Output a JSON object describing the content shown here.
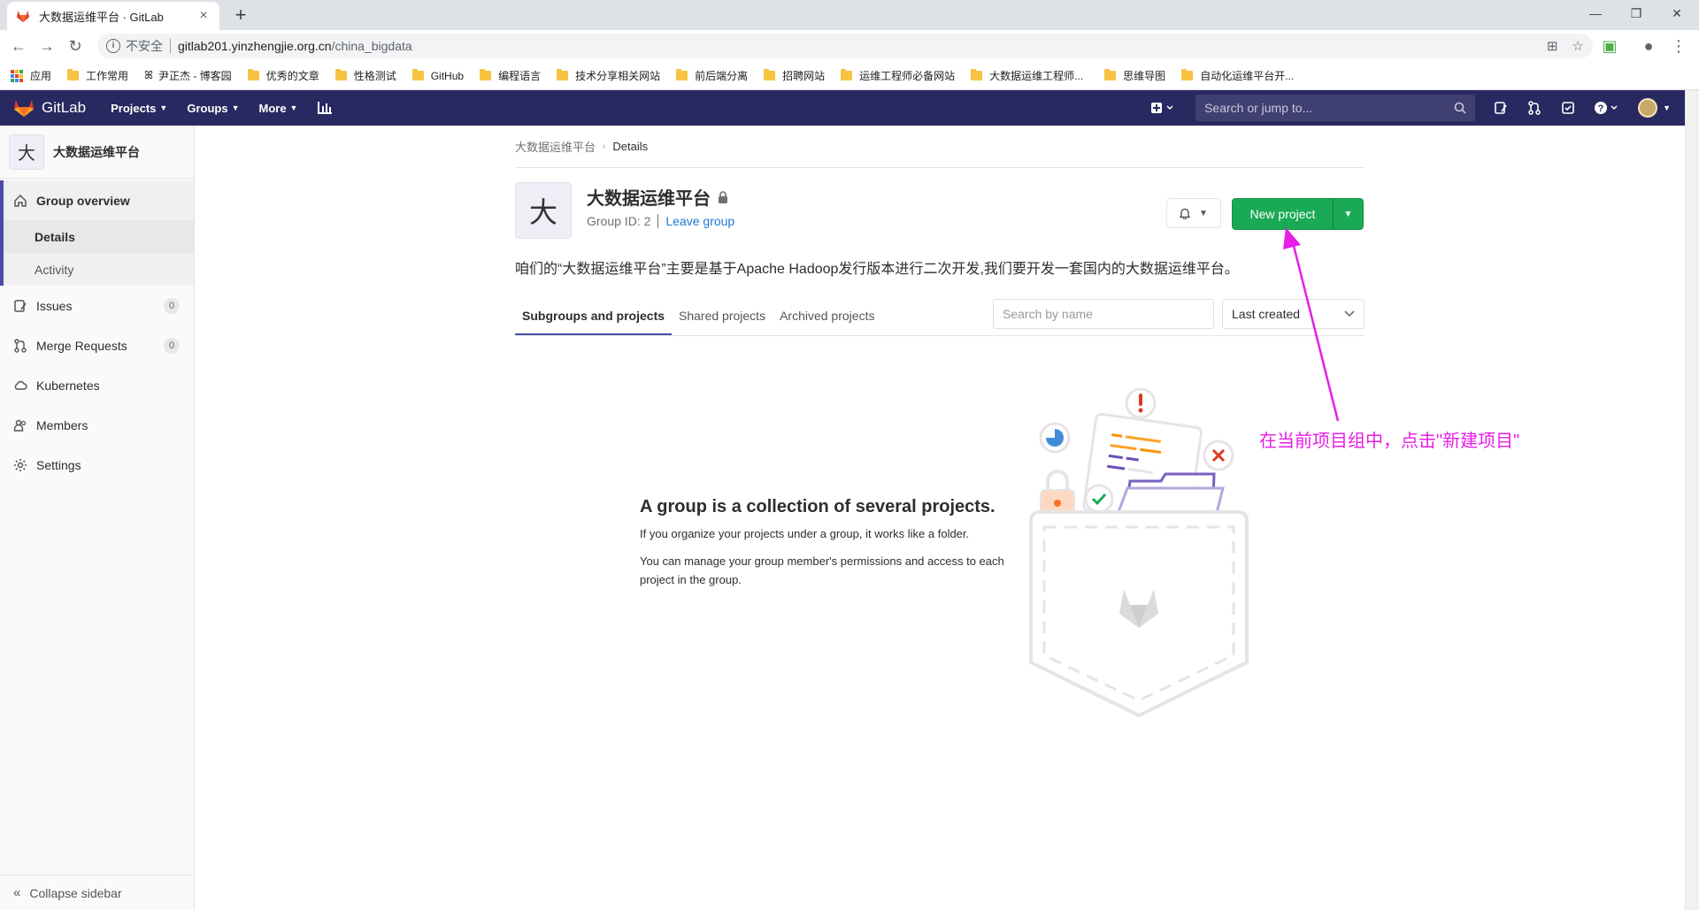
{
  "browser": {
    "tab_title": "大数据运维平台 · GitLab",
    "insecure_label": "不安全",
    "url_host": "gitlab201.yinzhengjie.org.cn",
    "url_path": "/china_bigdata",
    "bookmarks": {
      "apps": "应用",
      "b1": "工作常用",
      "b2": "尹正杰 - 博客园",
      "b3": "优秀的文章",
      "b4": "性格测试",
      "b5": "GitHub",
      "b6": "编程语言",
      "b7": "技术分享相关网站",
      "b8": "前后端分离",
      "b9": "招聘网站",
      "b10": "运维工程师必备网站",
      "b11": "大数据运维工程师...",
      "b12": "思维导图",
      "b13": "自动化运维平台开..."
    }
  },
  "header": {
    "brand": "GitLab",
    "nav_projects": "Projects",
    "nav_groups": "Groups",
    "nav_more": "More",
    "search_placeholder": "Search or jump to..."
  },
  "sidebar": {
    "group_initial": "大",
    "group_name": "大数据运维平台",
    "overview": "Group overview",
    "details": "Details",
    "activity": "Activity",
    "issues": "Issues",
    "issues_count": "0",
    "merge_requests": "Merge Requests",
    "mr_count": "0",
    "kubernetes": "Kubernetes",
    "members": "Members",
    "settings": "Settings",
    "collapse": "Collapse sidebar"
  },
  "main": {
    "breadcrumb_group": "大数据运维平台",
    "breadcrumb_current": "Details",
    "group_initial": "大",
    "group_title": "大数据运维平台",
    "group_id": "Group ID: 2",
    "leave_group": "Leave group",
    "new_project": "New project",
    "description": "咱们的“大数据运维平台”主要是基于Apache Hadoop发行版本进行二次开发,我们要开发一套国内的大数据运维平台。",
    "tabs": [
      "Subgroups and projects",
      "Shared projects",
      "Archived projects"
    ],
    "search_placeholder": "Search by name",
    "sort_value": "Last created",
    "empty_title": "A group is a collection of several projects.",
    "empty_p1": "If you organize your projects under a group, it works like a folder.",
    "empty_p2": "You can manage your group member's permissions and access to each project in the group."
  },
  "annotation": {
    "text": "在当前项目组中，点击\"新建项目\"",
    "color": "#e61ee6"
  },
  "colors": {
    "header_bg": "#292961",
    "accent": "#4b4ba3",
    "success": "#1aaa55",
    "link": "#1f78d1"
  }
}
